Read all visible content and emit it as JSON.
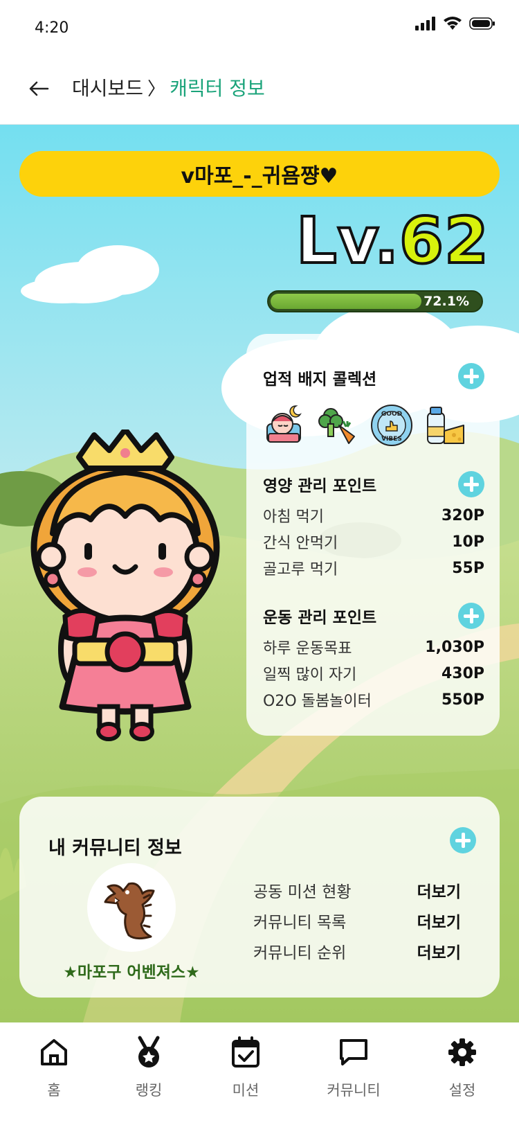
{
  "status": {
    "time": "4:20"
  },
  "header": {
    "parent": "대시보드",
    "separator": "〉",
    "current": "캐릭터 정보"
  },
  "character": {
    "nickname": "v마포_-_귀욤쨩♥",
    "level_prefix": "Lv.",
    "level": "62",
    "xp_percent": 72.1,
    "xp_label": "72.1%"
  },
  "stats": {
    "badges_title": "업적 배지 콜렉션",
    "badges": [
      "sleeping-child-icon",
      "vegetables-icon",
      "good-vibes-icon",
      "milk-cheese-icon"
    ],
    "nutrition_title": "영양 관리 포인트",
    "nutrition": [
      {
        "label": "아침 먹기",
        "value": "320P"
      },
      {
        "label": "간식 안먹기",
        "value": "10P"
      },
      {
        "label": "골고루 먹기",
        "value": "55P"
      }
    ],
    "exercise_title": "운동 관리 포인트",
    "exercise": [
      {
        "label": "하루 운동목표",
        "value": "1,030P"
      },
      {
        "label": "일찍 많이 자기",
        "value": "430P"
      },
      {
        "label": "O2O 돌봄놀이터",
        "value": "550P"
      }
    ]
  },
  "community": {
    "title": "내 커뮤니티 정보",
    "name": "★마포구 어벤져스★",
    "rows": [
      {
        "label": "공동 미션 현황",
        "link": "더보기"
      },
      {
        "label": "커뮤니티 목록",
        "link": "더보기"
      },
      {
        "label": "커뮤니티 순위",
        "link": "더보기"
      }
    ]
  },
  "nav": [
    {
      "label": "홈",
      "icon": "home-icon"
    },
    {
      "label": "랭킹",
      "icon": "medal-icon"
    },
    {
      "label": "미션",
      "icon": "calendar-check-icon"
    },
    {
      "label": "커뮤니티",
      "icon": "chat-icon"
    },
    {
      "label": "설정",
      "icon": "gear-icon"
    }
  ],
  "colors": {
    "accent": "#1aa37a",
    "nickname_bg": "#fdd20b",
    "level_number": "#d8f20c",
    "plus": "#5fd3df"
  }
}
